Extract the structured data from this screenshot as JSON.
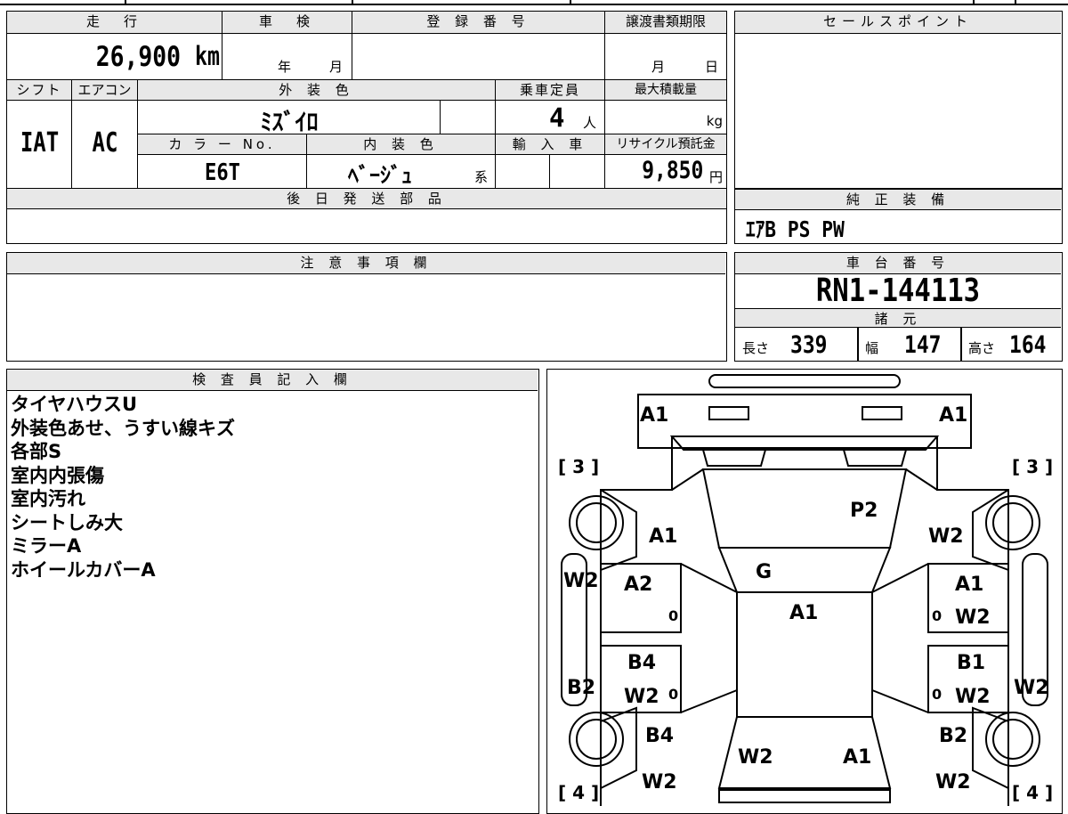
{
  "top_table": {
    "headers": {
      "mileage": "走　行",
      "inspection": "車　検",
      "registration": "登 録 番 号",
      "transfer_deadline": "譲渡書類期限",
      "shift": "シフト",
      "aircon": "エアコン",
      "exterior_color": "外 装 色",
      "capacity": "乗車定員",
      "max_load": "最大積載量",
      "color_no": "カ ラ ー No.",
      "interior_color": "内 装 色",
      "import": "輸 入 車",
      "recycle": "リサイクル預託金",
      "later_parts": "後 日 発 送 部 品"
    },
    "mileage_value": "26,900",
    "mileage_unit": "km",
    "year_label": "年",
    "month_label": "月",
    "deadline_month": "月",
    "deadline_day": "日",
    "shift_value": "IAT",
    "aircon_value": "AC",
    "exterior_color_value": "ﾐｽﾞｲﾛ",
    "capacity_value": "4",
    "capacity_unit": "人",
    "max_load_unit": "kg",
    "color_no_value": "E6T",
    "interior_color_value": "ﾍﾞｰｼﾞｭ",
    "interior_suffix": "系",
    "recycle_value": "9,850",
    "recycle_unit": "円"
  },
  "sales_point": {
    "header": "セールスポイント"
  },
  "genuine_equipment": {
    "header": "純 正 装 備",
    "value": "ｴｱB PS PW"
  },
  "notes_section": {
    "header": "注 意 事 項 欄"
  },
  "chassis": {
    "header": "車 台 番 号",
    "value": "RN1-144113"
  },
  "specs": {
    "header": "諸 元",
    "length_label": "長さ",
    "length_value": "339",
    "width_label": "幅",
    "width_value": "147",
    "height_label": "高さ",
    "height_value": "164"
  },
  "inspector": {
    "header": "検 査 員 記 入 欄",
    "lines": [
      "タイヤハウスU",
      "外装色あせ、うすい線キズ",
      "各部S",
      "室内内張傷",
      "室内汚れ",
      "シートしみ大",
      "ミラーA",
      "ホイールカバーA"
    ]
  },
  "diagram": {
    "tire_front_left": "[ 3 ]",
    "tire_front_right": "[ 3 ]",
    "tire_rear_left": "[ 4 ]",
    "tire_rear_right": "[ 4 ]",
    "marks": {
      "front_bumper_left": "A1",
      "front_bumper_right": "A1",
      "hood": "P2",
      "left_front_fender": "A1",
      "right_front_fender": "W2",
      "windshield": "G",
      "roof": "A1",
      "left_front_door": "A2",
      "right_front_door_1": "A1",
      "right_front_door_2": "W2",
      "left_pillar_front": "W2",
      "left_rear_door_1": "B4",
      "left_rear_door_2": "W2",
      "right_rear_door_1": "B1",
      "right_rear_door_2": "W2",
      "left_pillar_rear": "B2",
      "right_pillar_rear": "W2",
      "left_quarter": "B4",
      "right_quarter": "B2",
      "rear_left": "W2",
      "rear_right": "A1",
      "rear_bumper_left": "W2",
      "rear_bumper_right": "W2",
      "zero_marks": [
        "0",
        "0",
        "0",
        "0"
      ]
    }
  }
}
